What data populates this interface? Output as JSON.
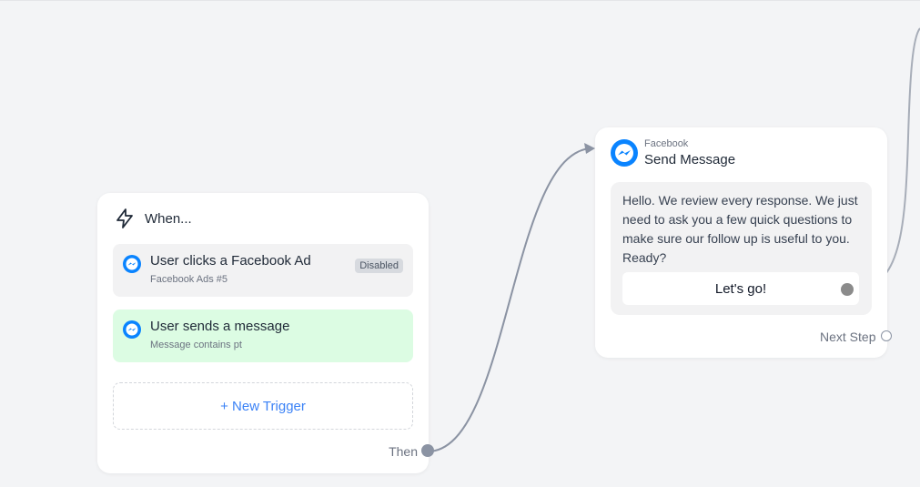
{
  "trigger_card": {
    "heading": "When...",
    "triggers": [
      {
        "title": "User clicks a Facebook Ad",
        "subtitle": "Facebook Ads #5",
        "badge": "Disabled",
        "state": "disabled"
      },
      {
        "title": "User sends a message",
        "subtitle": "Message contains pt",
        "state": "active"
      }
    ],
    "new_trigger_label": "+ New Trigger",
    "then_label": "Then"
  },
  "message_card": {
    "platform": "Facebook",
    "title": "Send Message",
    "body": "Hello. We review every response. We just need to ask you a few quick questions to make sure our follow up is useful to you. Ready?",
    "button_label": "Let's go!",
    "next_step_label": "Next Step"
  },
  "icons": {
    "trigger": "lightning-bolt-icon",
    "messenger": "messenger-icon"
  },
  "colors": {
    "canvas_bg": "#f3f4f6",
    "active_trigger_bg": "#dcfce3",
    "disabled_trigger_bg": "#f2f2f3",
    "accent_link": "#3b82f6",
    "connector": "#8b93a3",
    "messenger_blue": "#0a84ff"
  }
}
